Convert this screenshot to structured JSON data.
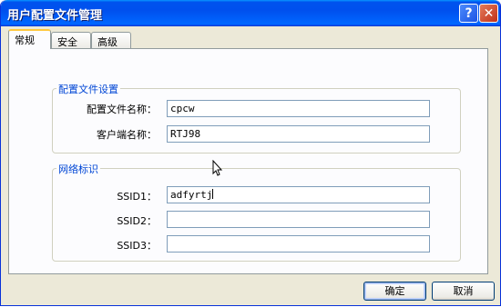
{
  "window": {
    "title": "用户配置文件管理"
  },
  "titlebar": {
    "help_label": "?",
    "close_label": "✕"
  },
  "tabs": [
    {
      "label": "常规",
      "active": true
    },
    {
      "label": "安全",
      "active": false
    },
    {
      "label": "高级",
      "active": false
    }
  ],
  "profile_settings": {
    "title": "配置文件设置",
    "profile_name_label": "配置文件名称：",
    "profile_name_value": "cpcw",
    "client_name_label": "客户端名称：",
    "client_name_value": "RTJ98"
  },
  "network_id": {
    "title": "网络标识",
    "ssid1_label": "SSID1：",
    "ssid1_value": "adfyrtj",
    "ssid2_label": "SSID2：",
    "ssid2_value": "",
    "ssid3_label": "SSID3：",
    "ssid3_value": ""
  },
  "buttons": {
    "ok_label": "确定",
    "cancel_label": "取消"
  }
}
